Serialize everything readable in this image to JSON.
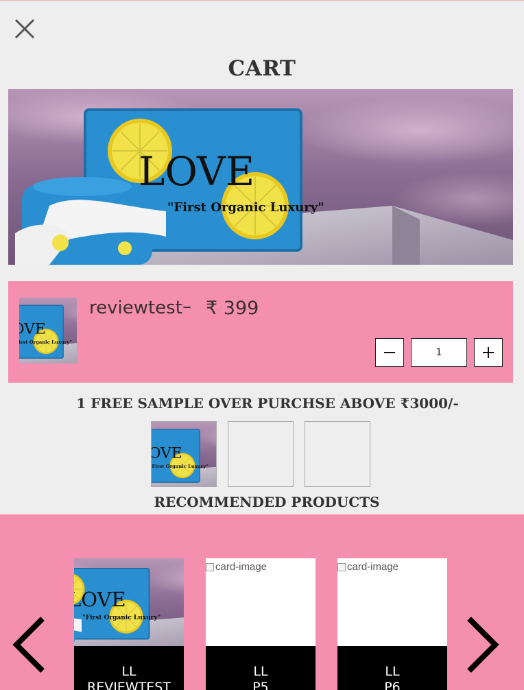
{
  "page": {
    "title": "CART"
  },
  "banner": {
    "brand_text": "LOVE",
    "tagline": "“First Organic Luxury”"
  },
  "cart_item": {
    "name": "reviewtest",
    "separator": "–",
    "price": "₹ 399",
    "quantity": "1"
  },
  "samples": {
    "title": "1 FREE SAMPLE OVER PURCHSE ABOVE ₹3000/-"
  },
  "recommended": {
    "title": "RECOMMENDED PRODUCTS",
    "cards": [
      {
        "line1": "LL",
        "line2": "REVIEWTEST"
      },
      {
        "alt": "card-image",
        "line1": "LL",
        "line2": "P5"
      },
      {
        "alt": "card-image",
        "line1": "LL",
        "line2": "P6"
      }
    ]
  },
  "colors": {
    "pink": "#f48fb0",
    "background": "#eeeeee",
    "black": "#000000"
  }
}
